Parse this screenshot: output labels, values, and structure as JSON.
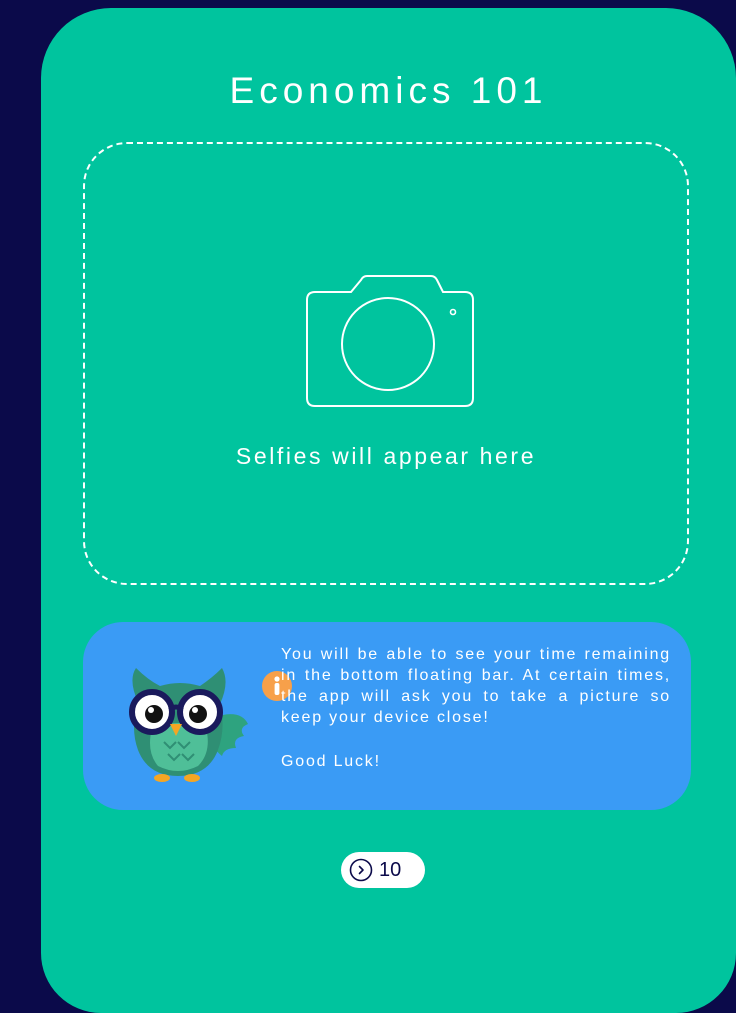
{
  "colors": {
    "background": "#0b0a4a",
    "card": "#00c49e",
    "info_card": "#3a9bf5",
    "text": "#ffffff",
    "counter_text": "#0b0a4a"
  },
  "header": {
    "title": "Economics 101"
  },
  "selfie_area": {
    "icon": "camera-icon",
    "placeholder_text": "Selfies will appear here"
  },
  "info": {
    "mascot": "owl-mascot",
    "badge_icon": "info-icon",
    "message": "You will be able to see your time remaining in the bottom floating bar. At certain times, the app will ask you to take a picture so keep your device close!",
    "sign_off": "Good Luck!"
  },
  "counter": {
    "icon": "chevron-right-circle-icon",
    "value": "10"
  }
}
